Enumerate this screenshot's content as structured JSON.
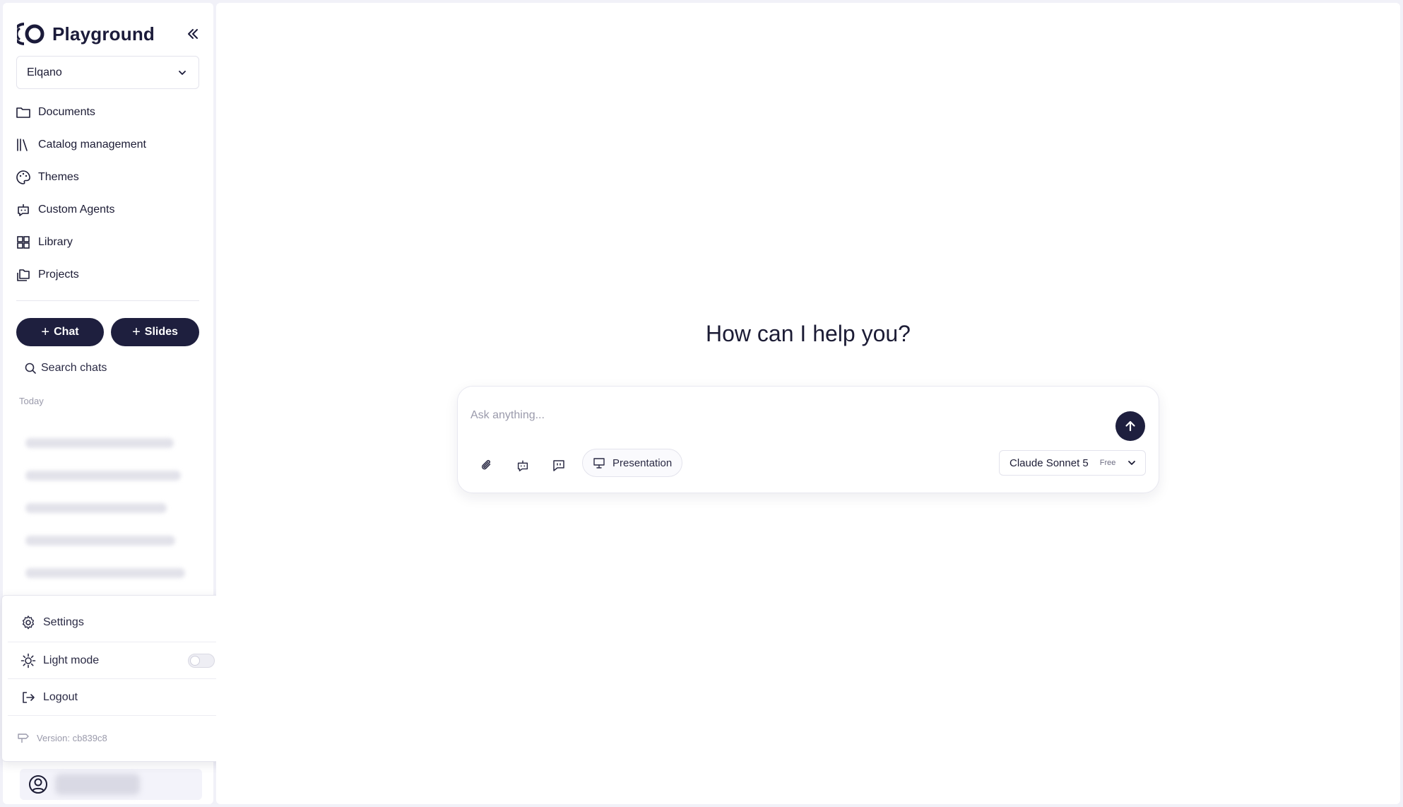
{
  "brand": {
    "name": "Playground"
  },
  "org": {
    "selected": "Elqano"
  },
  "nav": [
    {
      "label": "Documents",
      "icon": "folder-icon"
    },
    {
      "label": "Catalog management",
      "icon": "books-icon"
    },
    {
      "label": "Themes",
      "icon": "palette-icon"
    },
    {
      "label": "Custom Agents",
      "icon": "bot-icon"
    },
    {
      "label": "Library",
      "icon": "grid-icon"
    },
    {
      "label": "Projects",
      "icon": "folders-icon"
    }
  ],
  "actions": {
    "chat_label": "Chat",
    "slides_label": "Slides"
  },
  "search": {
    "label": "Search chats"
  },
  "history": {
    "section": "Today"
  },
  "menu": {
    "settings_label": "Settings",
    "light_mode_label": "Light mode",
    "light_mode_on": false,
    "logout_label": "Logout",
    "version": "Version: cb839c8"
  },
  "main": {
    "headline": "How can I help you?",
    "input_placeholder": "Ask anything...",
    "chip_label": "Presentation",
    "model": {
      "name": "Claude Sonnet 5",
      "badge": "Free"
    }
  },
  "colors": {
    "primary": "#1e1f3e",
    "background": "#f1f1f8",
    "surface": "#ffffff"
  }
}
